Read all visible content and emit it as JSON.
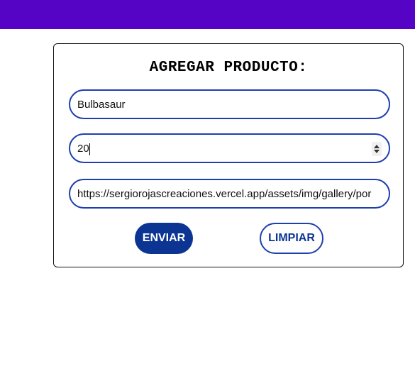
{
  "colors": {
    "topbar": "#5503c5",
    "accent": "#0c3593",
    "field_border": "#1f3fae"
  },
  "form": {
    "title": "AGREGAR PRODUCTO:",
    "name_value": "Bulbasaur",
    "price_value": "20",
    "image_url_value": "https://sergiorojascreaciones.vercel.app/assets/img/gallery/por",
    "submit_label": "ENVIAR",
    "clear_label": "LIMPIAR"
  }
}
